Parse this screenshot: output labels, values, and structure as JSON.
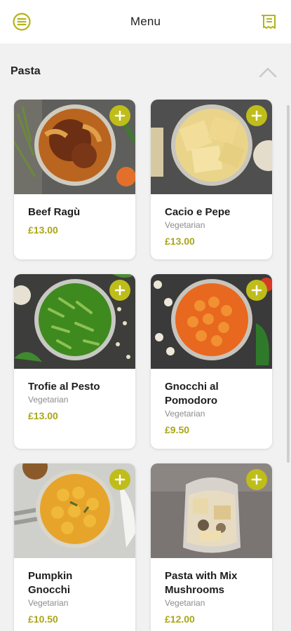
{
  "header": {
    "title": "Menu",
    "menu_icon": "hamburger-circle-icon",
    "receipt_icon": "receipt-icon"
  },
  "section": {
    "label": "Pasta",
    "collapse_icon": "chevron-up-icon"
  },
  "colors": {
    "accent": "#bfbd1a",
    "price": "#a9a617",
    "background": "#f1f1f1"
  },
  "items": [
    {
      "name": "Beef Ragù",
      "tag": "",
      "price": "£13.00"
    },
    {
      "name": "Cacio e Pepe",
      "tag": "Vegetarian",
      "price": "£13.00"
    },
    {
      "name": "Trofie al Pesto",
      "tag": "Vegetarian",
      "price": "£13.00"
    },
    {
      "name": "Gnocchi al Pomodoro",
      "tag": "Vegetarian",
      "price": "£9.50"
    },
    {
      "name": "Pumpkin Gnocchi",
      "tag": "Vegetarian",
      "price": "£10.50"
    },
    {
      "name": "Pasta with Mix Mushrooms",
      "tag": "Vegetarian",
      "price": "£12.00"
    }
  ]
}
